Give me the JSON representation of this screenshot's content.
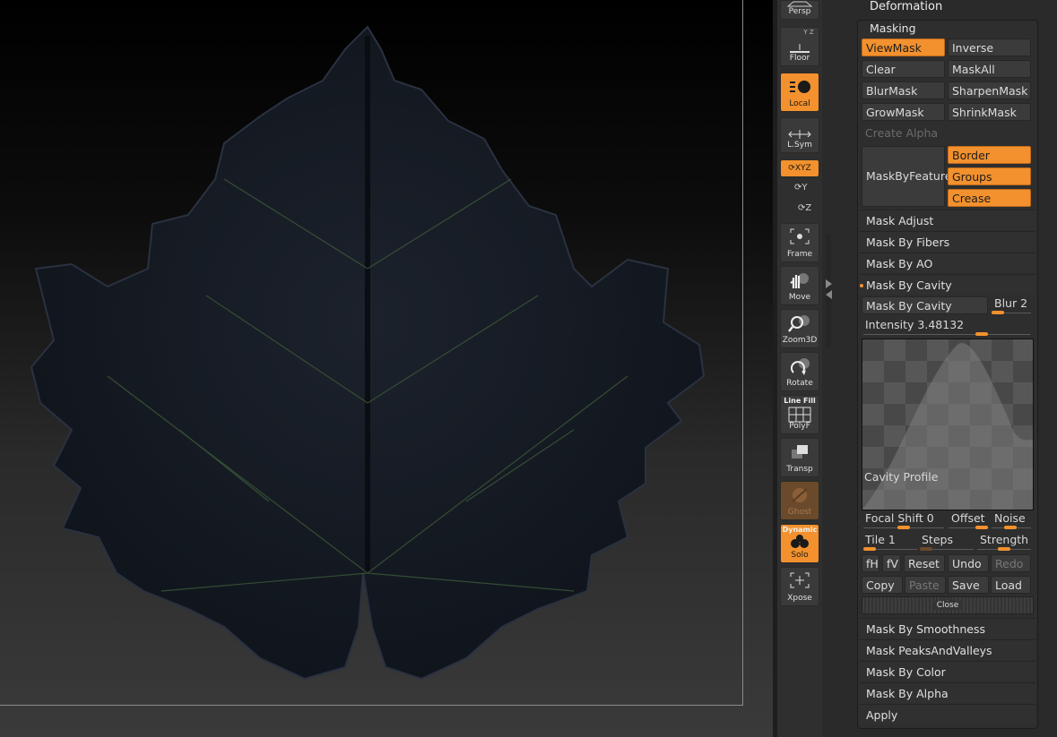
{
  "shelf": {
    "persp": "Persp",
    "floor": "Floor",
    "floor_axes": "Y Z",
    "local": "Local",
    "lsym": "L.Sym",
    "xyz": "XYZ",
    "y": "Y",
    "z": "Z",
    "frame": "Frame",
    "move": "Move",
    "zoom3d": "Zoom3D",
    "rotate": "Rotate",
    "linefill": "Line Fill",
    "polyf": "PolyF",
    "transp": "Transp",
    "ghost": "Ghost",
    "dynamic": "Dynamic",
    "solo": "Solo",
    "xpose": "Xpose"
  },
  "panel": {
    "deformation": "Deformation",
    "masking": "Masking",
    "viewmask": "ViewMask",
    "inverse": "Inverse",
    "clear": "Clear",
    "maskall": "MaskAll",
    "blurmask": "BlurMask",
    "sharpenmask": "SharpenMask",
    "growmask": "GrowMask",
    "shrinkmask": "ShrinkMask",
    "create_alpha": "Create Alpha",
    "maskbyfeature": "MaskByFeature",
    "border": "Border",
    "groups": "Groups",
    "crease": "Crease",
    "mask_adjust": "Mask Adjust",
    "mask_by_fibers": "Mask By Fibers",
    "mask_by_ao": "Mask By AO",
    "mask_by_cavity_header": "Mask By Cavity",
    "mask_by_cavity_btn": "Mask By Cavity",
    "blur_label": "Blur",
    "blur_value": "2",
    "intensity_label": "Intensity",
    "intensity_value": "3.48132",
    "cavity_profile": "Cavity Profile",
    "focal_shift_label": "Focal Shift",
    "focal_shift_value": "0",
    "offset": "Offset",
    "noise": "Noise",
    "tile_label": "Tile",
    "tile_value": "1",
    "steps": "Steps",
    "strength": "Strength",
    "fh": "fH",
    "fv": "fV",
    "reset": "Reset",
    "undo": "Undo",
    "redo": "Redo",
    "copy": "Copy",
    "paste": "Paste",
    "save": "Save",
    "load": "Load",
    "close": "Close",
    "mask_by_smoothness": "Mask By Smoothness",
    "mask_peaks_valleys": "Mask PeaksAndValleys",
    "mask_by_color": "Mask By Color",
    "mask_by_alpha": "Mask By Alpha",
    "apply": "Apply"
  },
  "colors": {
    "accent": "#f2912d",
    "panel_bg": "#2e2e2e",
    "leaf": "#141a22"
  }
}
